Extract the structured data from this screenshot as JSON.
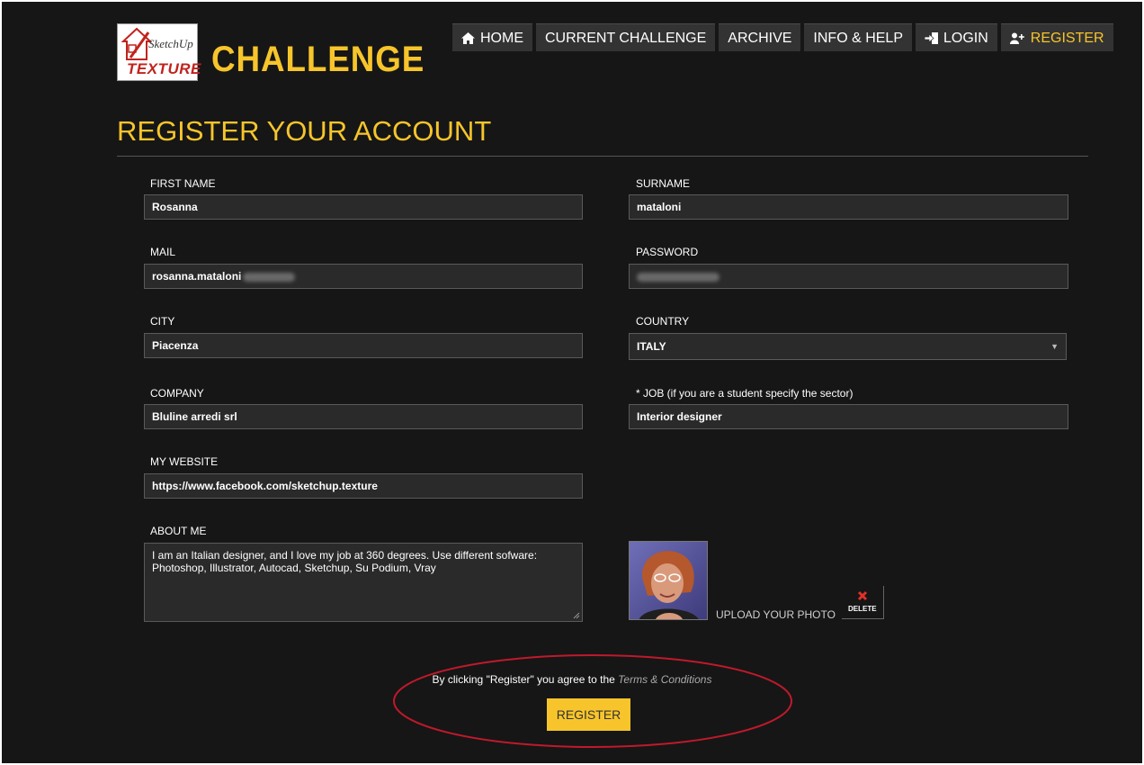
{
  "logo": {
    "sketchup": "SketchUp",
    "texture": "TEXTURE",
    "challenge": "CHALLENGE"
  },
  "nav": [
    {
      "label": "HOME",
      "icon": "home-icon"
    },
    {
      "label": "CURRENT CHALLENGE"
    },
    {
      "label": "ARCHIVE"
    },
    {
      "label": "INFO & HELP"
    },
    {
      "label": "LOGIN",
      "icon": "login-icon"
    },
    {
      "label": "REGISTER",
      "icon": "add-user-icon",
      "active": true
    }
  ],
  "title": "REGISTER YOUR ACCOUNT",
  "form": {
    "first_name": {
      "label": "FIRST NAME",
      "value": "Rosanna"
    },
    "surname": {
      "label": "SURNAME",
      "value": "mataloni"
    },
    "mail": {
      "label": "MAIL",
      "value": "rosanna.mataloni"
    },
    "password": {
      "label": "PASSWORD"
    },
    "city": {
      "label": "CITY",
      "value": "Piacenza"
    },
    "country": {
      "label": "COUNTRY",
      "value": "ITALY"
    },
    "company": {
      "label": "COMPANY",
      "value": "Bluline arredi srl"
    },
    "job": {
      "label": "* JOB (if you are a student specify the sector)",
      "value": "Interior designer"
    },
    "website": {
      "label": "MY WEBSITE",
      "value": "https://www.facebook.com/sketchup.texture"
    },
    "about": {
      "label": "ABOUT ME",
      "value": "I am an Italian designer, and I love my job at 360 degrees. Use different sofware: Photoshop, Illustrator, Autocad, Sketchup, Su Podium, Vray"
    }
  },
  "photo": {
    "upload_label": "UPLOAD YOUR PHOTO",
    "delete_label": "DELETE"
  },
  "terms": {
    "prefix": "By clicking \"Register\" you agree to the ",
    "link": "Terms & Conditions"
  },
  "register_button": "REGISTER",
  "colors": {
    "accent": "#f7c52b",
    "background": "#161616",
    "annotation": "#c0192b"
  }
}
